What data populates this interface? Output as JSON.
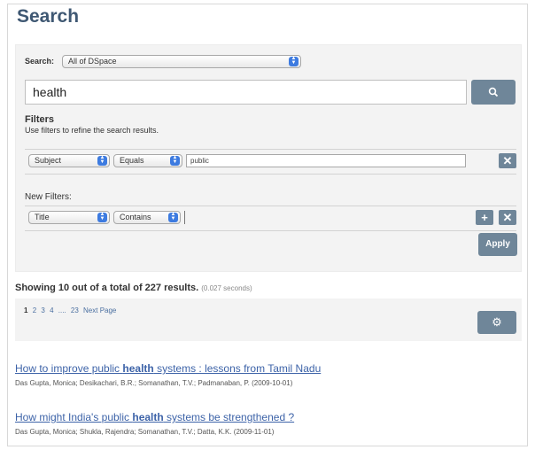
{
  "page": {
    "title": "Search"
  },
  "scope": {
    "label": "Search:",
    "value": "All of DSpace"
  },
  "query": {
    "value": "health"
  },
  "filters": {
    "title": "Filters",
    "help": "Use filters to refine the search results.",
    "active": {
      "field": "Subject",
      "operator": "Equals",
      "value": "public"
    }
  },
  "new_filters": {
    "label": "New Filters:",
    "field": "Title",
    "operator": "Contains",
    "value": ""
  },
  "apply_label": "Apply",
  "summary": {
    "text": "Showing 10 out of a total of 227 results.",
    "time": "(0.027 seconds)"
  },
  "pagination": {
    "pages": [
      "1",
      "2",
      "3",
      "4",
      "....",
      "23"
    ],
    "next": "Next Page"
  },
  "results": [
    {
      "title_before": "How to improve public ",
      "title_bold": "health",
      "title_after": " systems : lessons from Tamil Nadu",
      "meta": "Das Gupta, Monica; Desikachari, B.R.; Somanathan, T.V.; Padmanaban, P. (2009-10-01)"
    },
    {
      "title_before": "How might India's public ",
      "title_bold": "health",
      "title_after": " systems be strengthened ?",
      "meta": "Das Gupta, Monica; Shukla, Rajendra; Somanathan, T.V.; Datta, K.K. (2009-11-01)"
    }
  ],
  "icons": {
    "search": "search-icon",
    "remove": "close-icon",
    "add": "plus-icon",
    "options": "gear-icon"
  }
}
